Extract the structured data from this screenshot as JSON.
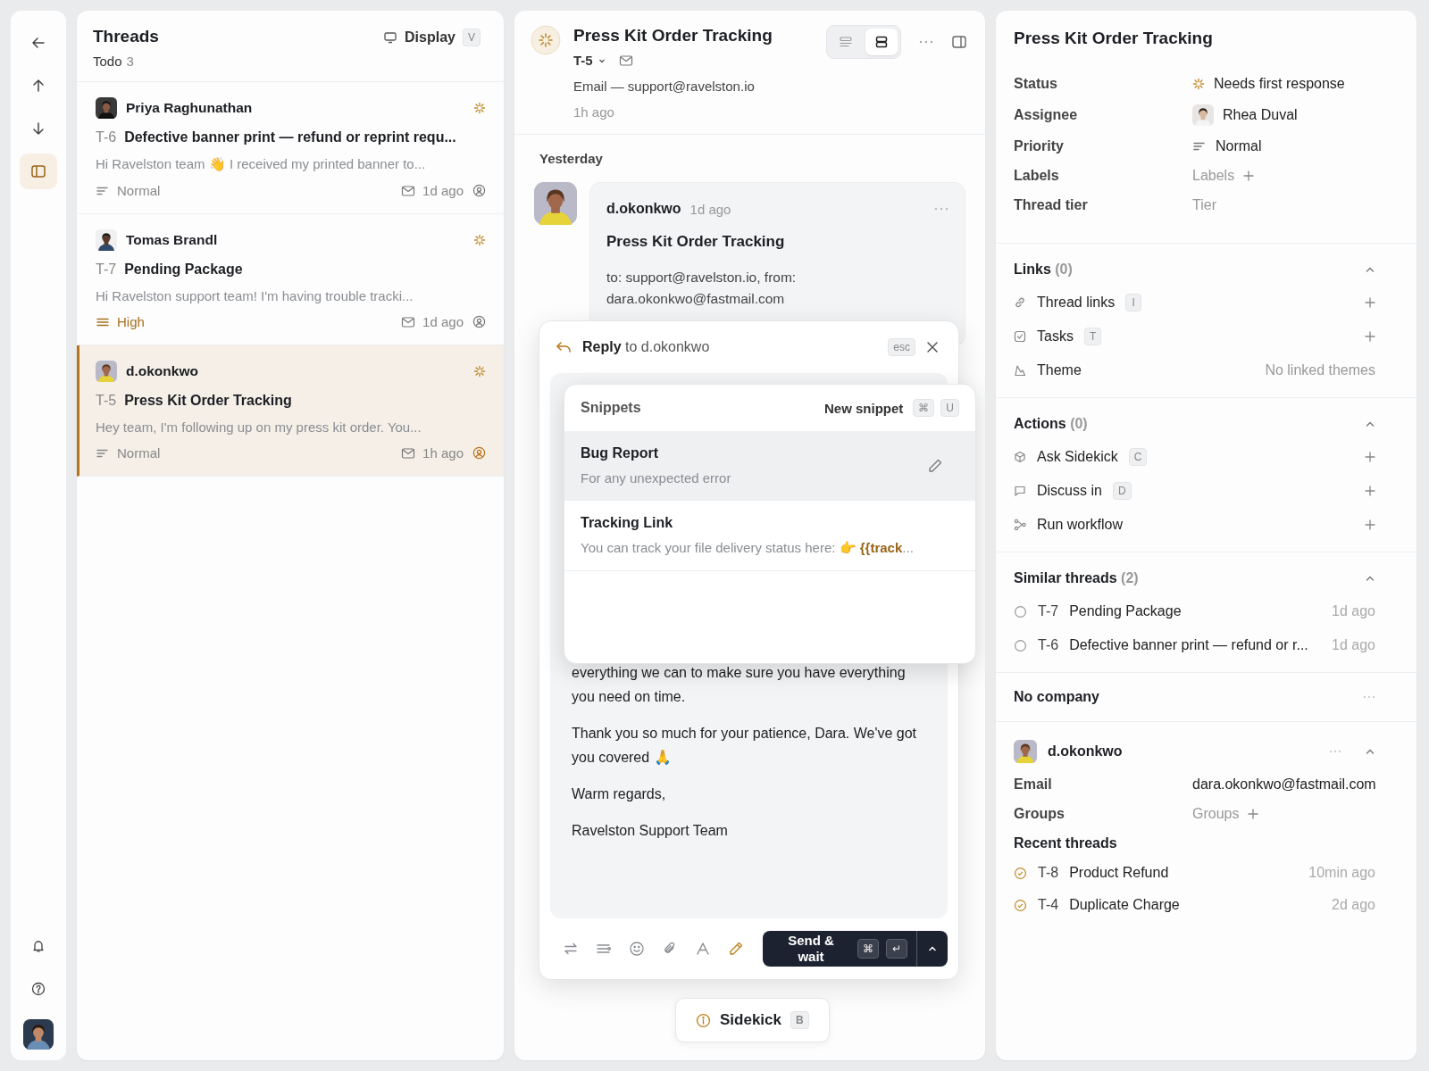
{
  "rail": {
    "items": [
      {
        "kind": "back",
        "selected": false
      },
      {
        "kind": "up",
        "selected": false
      },
      {
        "kind": "down",
        "selected": false
      },
      {
        "kind": "panel",
        "selected": true
      }
    ],
    "bottom_items": [
      {
        "kind": "bell",
        "selected": false
      },
      {
        "kind": "help",
        "selected": false
      }
    ]
  },
  "threads_panel": {
    "title": "Threads",
    "filter": "Todo",
    "count": "3",
    "display_button": "Display",
    "display_key": "V",
    "threads": [
      {
        "author": "Priya Raghunathan",
        "id": "T-6",
        "subject": "Defective banner print — refund or reprint requ...",
        "preview": "Hi Ravelston team 👋 I received my printed banner to...",
        "priority": "Normal",
        "priority_high": false,
        "time": "1d ago",
        "selected": false
      },
      {
        "author": "Tomas Brandl",
        "id": "T-7",
        "subject": "Pending Package",
        "preview": "Hi Ravelston support team! I'm having trouble tracki...",
        "priority": "High",
        "priority_high": true,
        "time": "1d ago",
        "selected": false
      },
      {
        "author": "d.okonkwo",
        "id": "T-5",
        "subject": "Press Kit Order Tracking",
        "preview": "Hey team, I'm following up on my press kit order. You...",
        "priority": "Normal",
        "priority_high": false,
        "time": "1h ago",
        "selected": true
      }
    ]
  },
  "thread_view": {
    "title": "Press Kit Order Tracking",
    "id": "T-5",
    "channel": "Email — support@ravelston.io",
    "time": "1h ago",
    "view_toggle": [
      {
        "kind": "list",
        "selected": false
      },
      {
        "kind": "split",
        "selected": true
      }
    ],
    "day": "Yesterday",
    "message": {
      "author": "d.okonkwo",
      "time": "1d ago",
      "subject": "Press Kit Order Tracking",
      "recipients": "to: support@ravelston.io, from: dara.okonkwo@fastmail.com"
    },
    "composer": {
      "action": "Reply",
      "recipient": "to d.okonkwo",
      "close_key": "esc",
      "body": [
        "everything we can to make sure you have everything you need on time.",
        "Thank you so much for your patience, Dara. We've got you covered 🙏",
        "Warm regards,",
        "Ravelston Support Team"
      ],
      "tools": [
        {
          "kind": "swap",
          "active": false
        },
        {
          "kind": "lines",
          "active": false
        },
        {
          "kind": "emoji",
          "active": false
        },
        {
          "kind": "attach",
          "active": false
        },
        {
          "kind": "font",
          "active": false
        },
        {
          "kind": "pen",
          "active": true
        }
      ],
      "send_button": "Send & wait",
      "send_keys": [
        "⌘",
        "↵"
      ],
      "snippets": {
        "title": "Snippets",
        "new_button": "New snippet",
        "new_keys": [
          "⌘",
          "U"
        ],
        "items": [
          {
            "title": "Bug Report",
            "preview": "For any unexpected error",
            "selected": true
          },
          {
            "title": "Tracking Link",
            "preview": "You can track your file delivery status here: 👉 **{{track**...",
            "selected": false
          }
        ]
      }
    },
    "sidekick_button": "Sidekick",
    "sidekick_key": "B"
  },
  "details": {
    "title": "Press Kit Order Tracking",
    "fields": [
      {
        "label": "Status",
        "value": "Needs first response",
        "kind": "status"
      },
      {
        "label": "Assignee",
        "value": "Rhea Duval",
        "kind": "person"
      },
      {
        "label": "Priority",
        "value": "Normal",
        "kind": "priority"
      },
      {
        "label": "Labels",
        "placeholder": "Labels",
        "kind": "add"
      },
      {
        "label": "Thread tier",
        "placeholder": "Tier",
        "kind": "empty"
      }
    ],
    "links": {
      "title": "Links",
      "count": "(0)",
      "expanded": true,
      "items": [
        {
          "kind": "link",
          "label": "Thread links",
          "key": "I"
        },
        {
          "kind": "task",
          "label": "Tasks",
          "key": "T"
        },
        {
          "kind": "theme",
          "label": "Theme",
          "note": "No linked themes"
        }
      ]
    },
    "actions": {
      "title": "Actions",
      "count": "(0)",
      "expanded": true,
      "items": [
        {
          "kind": "cube",
          "label": "Ask Sidekick",
          "key": "C"
        },
        {
          "kind": "chat",
          "label": "Discuss in",
          "key": "D"
        },
        {
          "kind": "workflow",
          "label": "Run workflow"
        }
      ]
    },
    "similar": {
      "title": "Similar threads",
      "count": "(2)",
      "expanded": true,
      "items": [
        {
          "id": "T-7",
          "title": "Pending Package",
          "time": "1d ago",
          "done": false
        },
        {
          "id": "T-6",
          "title": "Defective banner print — refund or r...",
          "time": "1d ago",
          "done": false
        }
      ]
    },
    "company": "No company",
    "contact": {
      "name": "d.okonkwo",
      "expanded": true,
      "fields": [
        {
          "label": "Email",
          "value": "dara.okonkwo@fastmail.com",
          "kind": "text"
        },
        {
          "label": "Groups",
          "placeholder": "Groups",
          "kind": "add"
        }
      ],
      "recent_title": "Recent threads",
      "recent": [
        {
          "id": "T-8",
          "title": "Product Refund",
          "time": "10min ago",
          "done": true
        },
        {
          "id": "T-4",
          "title": "Duplicate Charge",
          "time": "2d ago",
          "done": true
        }
      ]
    }
  }
}
